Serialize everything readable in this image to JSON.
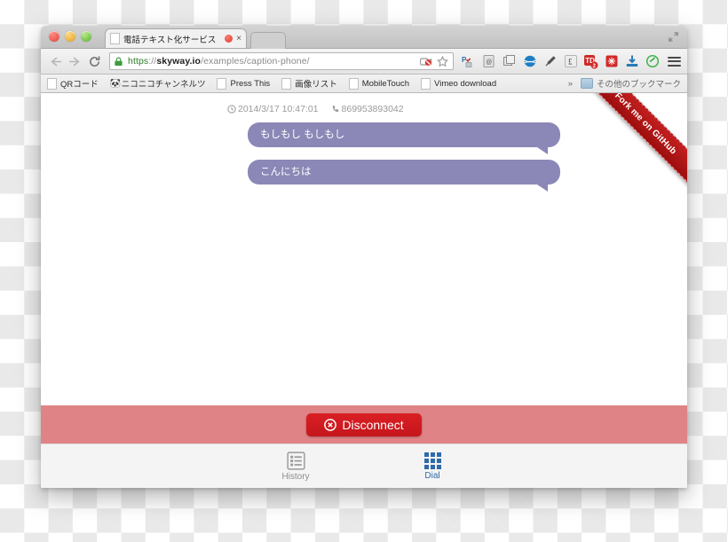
{
  "browser": {
    "window_controls": [
      "close",
      "minimize",
      "maximize"
    ],
    "fullscreen_icon": "fullscreen-arrows-icon",
    "tab": {
      "title": "電話テキスト化サービス",
      "favicon": "page-icon",
      "recording_indicator": "red-record-dot-icon",
      "close_label": "×"
    },
    "nav": {
      "back_icon": "back-arrow-icon",
      "forward_icon": "forward-arrow-icon",
      "reload_icon": "reload-icon"
    },
    "url": {
      "lock_icon": "green-lock-icon",
      "scheme": "https",
      "separator": "://",
      "host": "skyway.io",
      "path": "/examples/caption-phone/",
      "full": "https://skyway.io/examples/caption-phone/",
      "inline_icons": [
        "camera-blocked-icon",
        "bookmark-star-icon"
      ]
    },
    "extensions": [
      {
        "name": "pocket-extension-icon",
        "glyph": "P"
      },
      {
        "name": "evernote-clipper-icon",
        "glyph": "@"
      },
      {
        "name": "window-stack-icon",
        "glyph": "❐"
      },
      {
        "name": "globe-extension-icon",
        "glyph": "●"
      },
      {
        "name": "eyedropper-icon",
        "glyph": "✒"
      },
      {
        "name": "pound-currency-icon",
        "glyph": "£"
      },
      {
        "name": "tweetdeck-icon",
        "glyph": "TD",
        "badge": "2"
      },
      {
        "name": "asterisk-extension-icon",
        "glyph": "✳"
      },
      {
        "name": "download-tray-icon",
        "glyph": "⤓"
      },
      {
        "name": "green-check-circle-icon",
        "glyph": "✓"
      },
      {
        "name": "chrome-menu-icon",
        "glyph": "≡"
      }
    ],
    "bookmarks": [
      {
        "label": "QRコード",
        "icon": "page-icon"
      },
      {
        "label": "ニコニコチャンネルツ",
        "icon": "nicovideo-icon"
      },
      {
        "label": "Press This",
        "icon": "page-icon"
      },
      {
        "label": "画像リスト",
        "icon": "page-icon"
      },
      {
        "label": "MobileTouch",
        "icon": "page-icon"
      },
      {
        "label": "Vimeo download",
        "icon": "page-icon"
      }
    ],
    "bookmarks_overflow": {
      "chevron": "»",
      "other_bookmarks_label": "その他のブックマーク",
      "folder_icon": "folder-icon"
    }
  },
  "page": {
    "github_ribbon": {
      "label": "Fork me on GitHub",
      "color": "#c41f1f"
    },
    "call": {
      "clock_icon": "clock-icon",
      "timestamp": "2014/3/17 10:47:01",
      "phone_icon": "phone-handset-icon",
      "phone_number": "869953893042"
    },
    "messages": [
      {
        "text": "もしもし もしもし"
      },
      {
        "text": "こんにちは"
      }
    ],
    "bubble_color": "#8b88b7",
    "action_bar": {
      "background": "#e08386",
      "disconnect": {
        "label": "Disconnect",
        "icon": "circle-x-icon",
        "color": "#c4161c"
      }
    },
    "tabbar": [
      {
        "label": "History",
        "icon": "list-icon",
        "active": false
      },
      {
        "label": "Dial",
        "icon": "dialpad-icon",
        "active": true
      }
    ],
    "accent_color": "#2f6aa8"
  }
}
